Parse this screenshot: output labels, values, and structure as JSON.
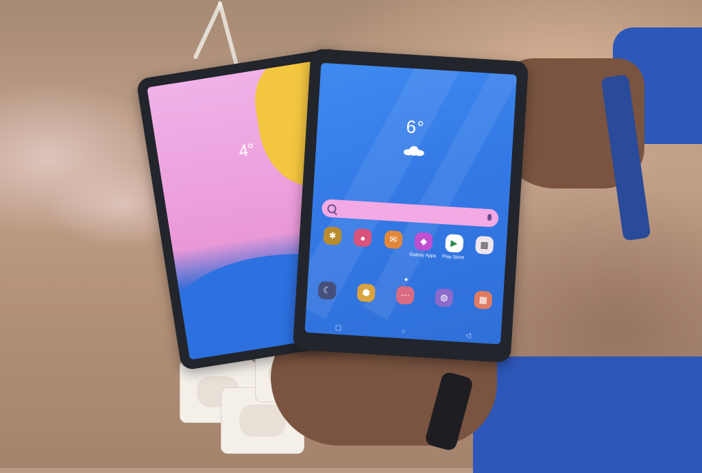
{
  "photo": {
    "left_tablet": {
      "clock": "4°"
    },
    "right_tablet": {
      "temperature": "6°",
      "apps": [
        "Galaxy Apps",
        "Play Store"
      ]
    }
  },
  "colors": {
    "sleeve": "#2d57b8",
    "left_screen_pink": "#ea9ad8",
    "left_screen_yellow": "#f3c640",
    "right_screen_blue": "#3479e6"
  },
  "icons": [
    "search-icon",
    "mic-icon",
    "gear-icon",
    "camera-icon",
    "email-icon",
    "galaxy-apps-icon",
    "play-store-icon",
    "folder-icon"
  ]
}
